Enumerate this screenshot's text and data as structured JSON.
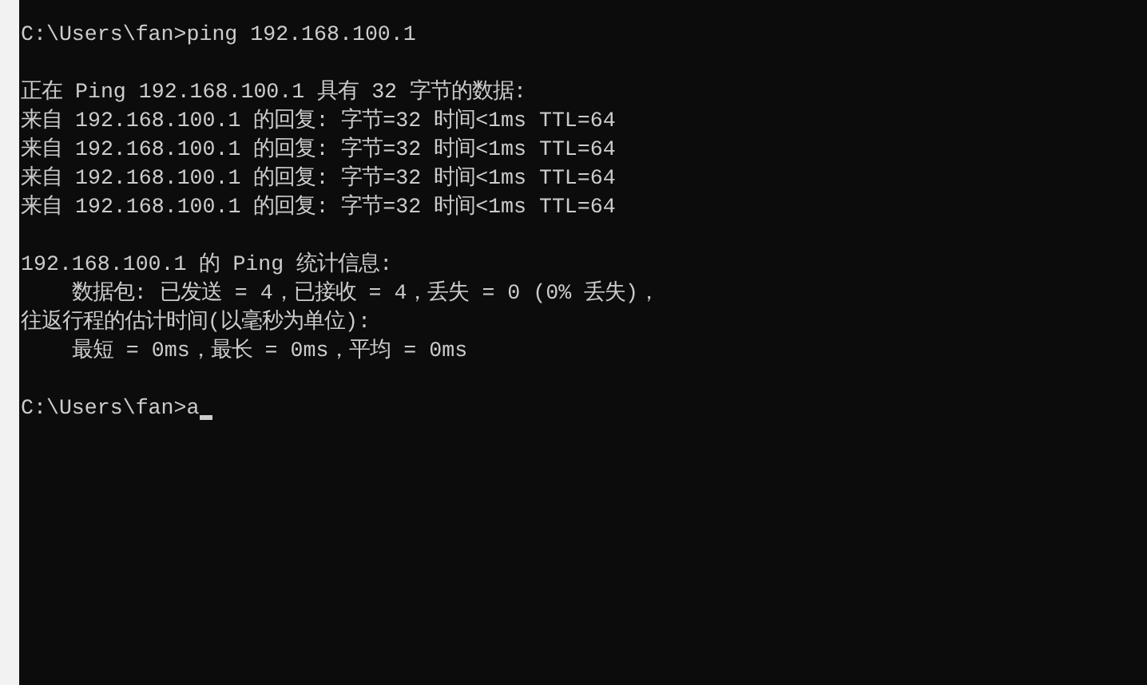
{
  "console": {
    "blocks": [
      [
        "C:\\Users\\fan>ping 192.168.100.1"
      ],
      [
        "正在 Ping 192.168.100.1 具有 32 字节的数据:",
        "来自 192.168.100.1 的回复: 字节=32 时间<1ms TTL=64",
        "来自 192.168.100.1 的回复: 字节=32 时间<1ms TTL=64",
        "来自 192.168.100.1 的回复: 字节=32 时间<1ms TTL=64",
        "来自 192.168.100.1 的回复: 字节=32 时间<1ms TTL=64"
      ],
      [
        "192.168.100.1 的 Ping 统计信息:",
        "    数据包: 已发送 = 4，已接收 = 4，丢失 = 0 (0% 丢失)，",
        "往返行程的估计时间(以毫秒为单位):",
        "    最短 = 0ms，最长 = 0ms，平均 = 0ms"
      ]
    ],
    "prompt": {
      "path": "C:\\Users\\fan>",
      "input": "a"
    }
  }
}
